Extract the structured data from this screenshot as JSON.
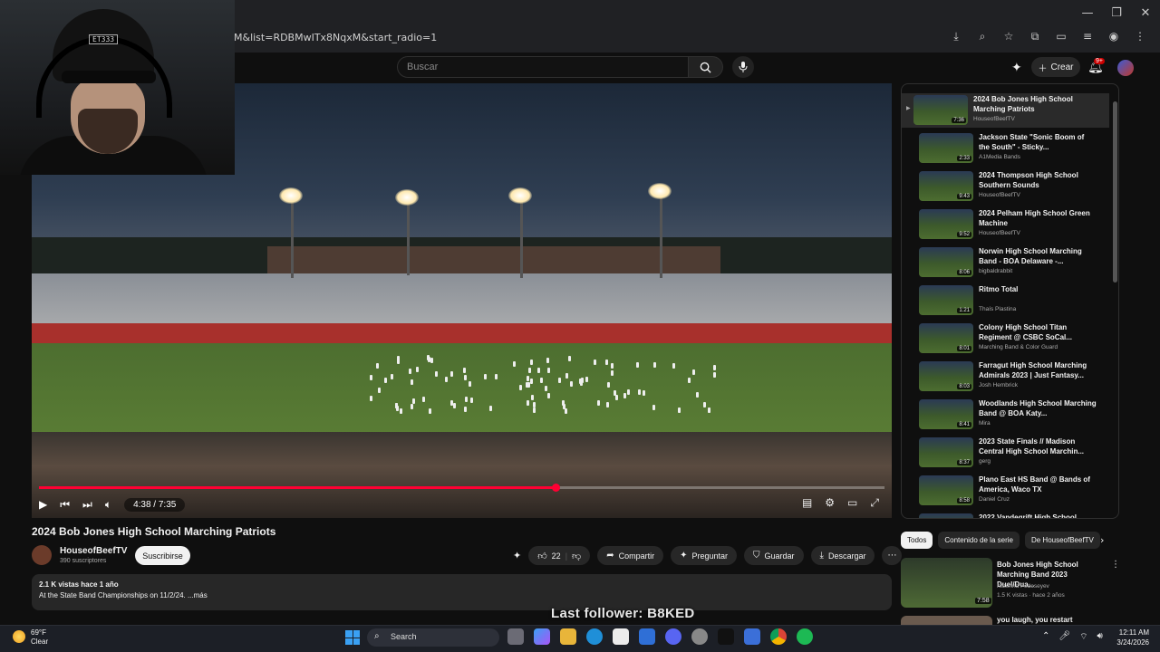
{
  "browser": {
    "url": "M&list=RDBMwITx8NqxM&start_radio=1",
    "window_controls": [
      "—",
      "❐",
      "✕"
    ],
    "toolbar_icons": [
      "install-icon",
      "zoom-icon",
      "star-icon",
      "extensions-icon",
      "sidebar-icon",
      "media-icon",
      "profile-icon",
      "menu-icon"
    ]
  },
  "header": {
    "search_placeholder": "Buscar",
    "create_label": "Crear",
    "notifications_badge": "9+"
  },
  "webcam": {
    "cap_text": "ET333"
  },
  "player": {
    "time": "4:38 / 7:35",
    "progress": 0.611
  },
  "video": {
    "title": "2024 Bob Jones High School Marching Patriots",
    "channel": "HouseofBeefTV",
    "subscribers": "390 suscriptores",
    "subscribe_label": "Suscribirse",
    "likes": "22",
    "share_label": "Compartir",
    "ask_label": "Preguntar",
    "save_label": "Guardar",
    "download_label": "Descargar",
    "views_line": "2.1 K vistas  hace 1 año",
    "description": "At the State Band Championships on 11/2/24.  ...más"
  },
  "overlay": {
    "last_follower": "Last follower: B8KED"
  },
  "playlist": [
    {
      "title": "2024 Bob Jones High School Marching Patriots",
      "channel": "HouseofBeefTV",
      "duration": "7:36",
      "active": true
    },
    {
      "title": "Jackson State \"Sonic Boom of the South\" - Sticky...",
      "channel": "A1Media Bands",
      "duration": "2:33",
      "active": false
    },
    {
      "title": "2024 Thompson High School Southern Sounds",
      "channel": "HouseofBeefTV",
      "duration": "9:43",
      "active": false
    },
    {
      "title": "2024 Pelham High School Green Machine",
      "channel": "HouseofBeefTV",
      "duration": "9:52",
      "active": false
    },
    {
      "title": "Norwin High School Marching Band - BOA Delaware -...",
      "channel": "bigbaldrabbit",
      "duration": "8:06",
      "active": false
    },
    {
      "title": "Ritmo Total",
      "channel": "Thaís Plastina",
      "duration": "1:21",
      "active": false
    },
    {
      "title": "Colony High School Titan Regiment @ CSBC SoCal...",
      "channel": "Marching Band & Color Guard",
      "duration": "8:01",
      "active": false
    },
    {
      "title": "Farragut High School Marching Admirals 2023 | Just Fantasy...",
      "channel": "Josh Hembrick",
      "duration": "8:03",
      "active": false
    },
    {
      "title": "Woodlands High School Marching Band @ BOA Katy...",
      "channel": "Mira",
      "duration": "8:41",
      "active": false
    },
    {
      "title": "2023 State Finals // Madison Central High School Marchin...",
      "channel": "gerg",
      "duration": "8:37",
      "active": false
    },
    {
      "title": "Plano East HS Band @ Bands of America, Waco TX",
      "channel": "Daniel Cruz",
      "duration": "8:58",
      "active": false
    },
    {
      "title": "2022 Vandegrift High School",
      "channel": "",
      "duration": "",
      "active": false
    }
  ],
  "chips": [
    "Todos",
    "Contenido de la serie",
    "De HouseofBeefTV"
  ],
  "recommendations": [
    {
      "title": "Bob Jones High School Marching Band 2023 Duel/Dua...",
      "channel": "Katerina Fedoseyev",
      "meta": "1.5 K vistas · hace 2 años",
      "duration": "7:58"
    },
    {
      "title": "you laugh, you restart",
      "channel": "",
      "meta": "",
      "duration": ""
    }
  ],
  "taskbar": {
    "temperature": "69°F",
    "condition": "Clear",
    "search_label": "Search",
    "time": "12:11 AM",
    "date": "3/24/2026"
  }
}
